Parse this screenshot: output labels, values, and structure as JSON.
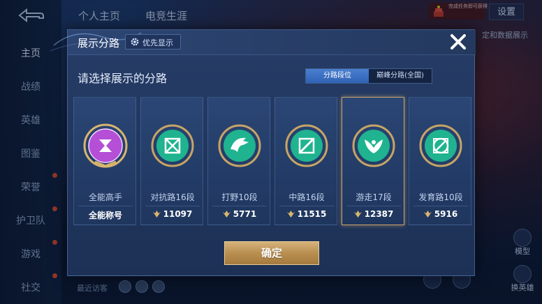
{
  "sidebar": {
    "items": [
      {
        "label": "主页",
        "active": true
      },
      {
        "label": "战绩"
      },
      {
        "label": "英雄"
      },
      {
        "label": "图鉴"
      },
      {
        "label": "荣誉"
      },
      {
        "label": "护卫队"
      },
      {
        "label": "游戏"
      },
      {
        "label": "社交"
      }
    ]
  },
  "top_tabs": [
    "个人主页",
    "电竞生涯"
  ],
  "top_right": {
    "settings_label": "设置",
    "badge_text": "完成任务即可获得",
    "side_text": "定和数据展示"
  },
  "right_icons": [
    {
      "label": "模型",
      "icon": "model-icon"
    },
    {
      "label": "换英雄",
      "icon": "swap-hero-icon"
    }
  ],
  "bottom": {
    "visitors_label": "最近访客"
  },
  "modal": {
    "title": "展示分路",
    "priority_label": "优先显示",
    "subtitle": "请选择展示的分路",
    "segments": [
      {
        "label": "分路段位",
        "active": true
      },
      {
        "label": "巅峰分路(全国)",
        "active": false
      }
    ],
    "cards": [
      {
        "name": "全能高手",
        "footer": "全能称号",
        "score_icon": false,
        "emblem_color": "#b44fd6",
        "selected": false
      },
      {
        "name": "对抗路16段",
        "footer": "11097",
        "score_icon": true,
        "emblem_color": "#1fb38f",
        "selected": false
      },
      {
        "name": "打野10段",
        "footer": "5771",
        "score_icon": true,
        "emblem_color": "#1fb38f",
        "selected": false
      },
      {
        "name": "中路16段",
        "footer": "11515",
        "score_icon": true,
        "emblem_color": "#1fb38f",
        "selected": false
      },
      {
        "name": "游走17段",
        "footer": "12387",
        "score_icon": true,
        "emblem_color": "#1fb38f",
        "selected": true
      },
      {
        "name": "发育路10段",
        "footer": "5916",
        "score_icon": true,
        "emblem_color": "#1fb38f",
        "selected": false
      }
    ],
    "confirm_label": "确定"
  },
  "colors": {
    "accent_gold": "#c9a36a",
    "segment_active": "#3a6fc2",
    "emblem_teal": "#1fb38f",
    "emblem_purple": "#b44fd6"
  }
}
